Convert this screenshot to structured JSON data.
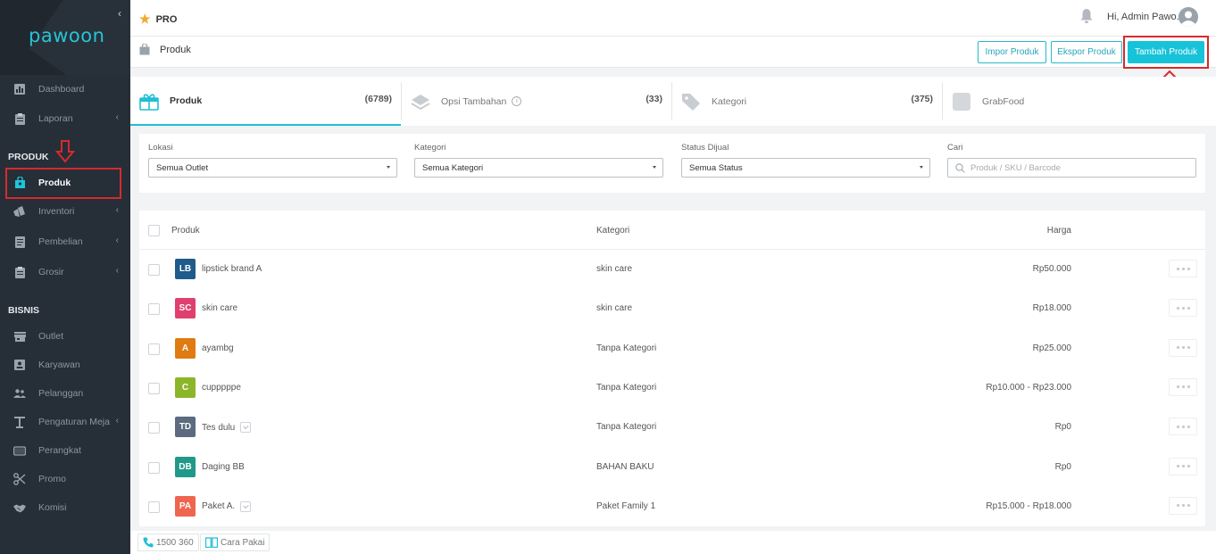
{
  "brand": {
    "name": "pawoon"
  },
  "topbar": {
    "plan": "PRO",
    "greeting": "Hi, Admin Pawo..."
  },
  "sidebar": {
    "items_top": [
      {
        "label": "Dashboard",
        "icon": "chart-icon"
      },
      {
        "label": "Laporan",
        "icon": "clipboard-icon"
      }
    ],
    "section_produk": "PRODUK",
    "items_produk": [
      {
        "label": "Produk",
        "icon": "bag-icon"
      },
      {
        "label": "Inventori",
        "icon": "boxes-icon"
      },
      {
        "label": "Pembelian",
        "icon": "document-icon"
      },
      {
        "label": "Grosir",
        "icon": "clipboard-icon"
      }
    ],
    "section_bisnis": "BISNIS",
    "items_bisnis": [
      {
        "label": "Outlet",
        "icon": "store-icon"
      },
      {
        "label": "Karyawan",
        "icon": "badge-icon"
      },
      {
        "label": "Pelanggan",
        "icon": "people-icon"
      },
      {
        "label": "Pengaturan Meja",
        "icon": "table-icon"
      },
      {
        "label": "Perangkat",
        "icon": "tablet-icon"
      },
      {
        "label": "Promo",
        "icon": "scissors-icon"
      },
      {
        "label": "Komisi",
        "icon": "handshake-icon"
      }
    ]
  },
  "page": {
    "title": "Produk",
    "buttons": {
      "import": "Impor Produk",
      "export": "Ekspor Produk",
      "add": "Tambah Produk"
    }
  },
  "tabs": [
    {
      "label": "Produk",
      "count": "(6789)"
    },
    {
      "label": "Opsi Tambahan",
      "count": "(33)"
    },
    {
      "label": "Kategori",
      "count": "(375)"
    },
    {
      "label": "GrabFood",
      "count": ""
    }
  ],
  "filters": {
    "lokasi": {
      "label": "Lokasi",
      "value": "Semua Outlet"
    },
    "kategori": {
      "label": "Kategori",
      "value": "Semua Kategori"
    },
    "status": {
      "label": "Status Dijual",
      "value": "Semua Status"
    },
    "cari": {
      "label": "Cari",
      "placeholder": "Produk / SKU / Barcode"
    }
  },
  "table": {
    "headers": {
      "produk": "Produk",
      "kategori": "Kategori",
      "harga": "Harga"
    },
    "rows": [
      {
        "initials": "LB",
        "color": "#1f5c8b",
        "name": "lipstick brand A",
        "badge": false,
        "category": "skin care",
        "price": "Rp50.000"
      },
      {
        "initials": "SC",
        "color": "#e0406f",
        "name": "skin care",
        "badge": false,
        "category": "skin care",
        "price": "Rp18.000"
      },
      {
        "initials": "A",
        "color": "#e07b12",
        "name": "ayambg",
        "badge": false,
        "category": "Tanpa Kategori",
        "price": "Rp25.000"
      },
      {
        "initials": "C",
        "color": "#8cb62a",
        "name": "cupppppe",
        "badge": false,
        "category": "Tanpa Kategori",
        "price": "Rp10.000 - Rp23.000"
      },
      {
        "initials": "TD",
        "color": "#5c6b80",
        "name": "Tes dulu",
        "badge": true,
        "category": "Tanpa Kategori",
        "price": "Rp0"
      },
      {
        "initials": "DB",
        "color": "#21998a",
        "name": "Daging BB",
        "badge": false,
        "category": "BAHAN BAKU",
        "price": "Rp0"
      },
      {
        "initials": "PA",
        "color": "#ef6550",
        "name": "Paket A.",
        "badge": true,
        "category": "Paket Family 1",
        "price": "Rp15.000 - Rp18.000"
      }
    ]
  },
  "footer": {
    "phone": "1500 360",
    "guide": "Cara Pakai"
  },
  "colors": {
    "accent": "#17c3d8",
    "sidebar": "#262e38",
    "annotation": "#d52b2b"
  }
}
